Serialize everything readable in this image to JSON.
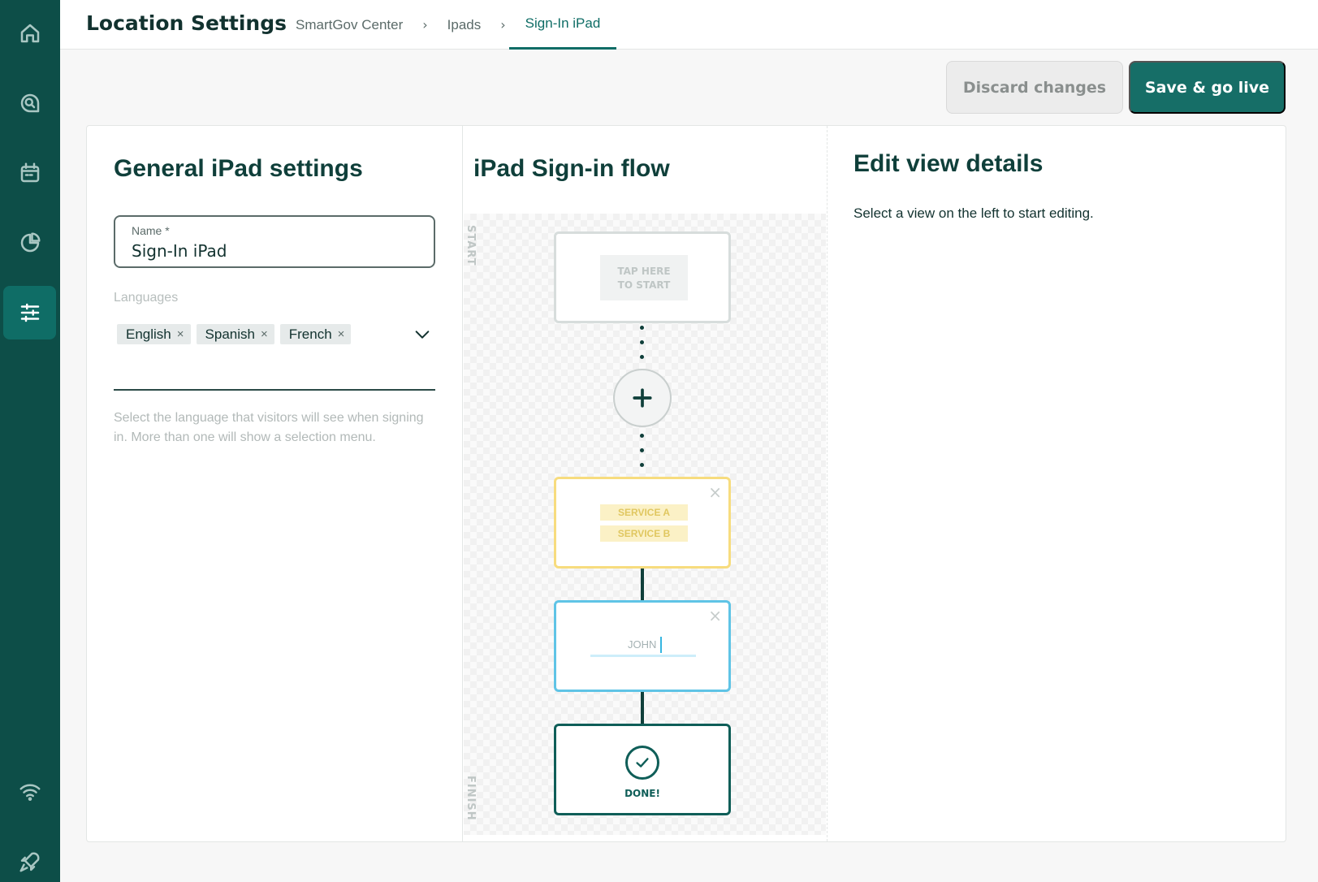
{
  "sidebar": {
    "items": [
      {
        "icon": "home-icon",
        "active": false
      },
      {
        "icon": "chat-search-icon",
        "active": false
      },
      {
        "icon": "calendar-icon",
        "active": false
      },
      {
        "icon": "pie-chart-icon",
        "active": false
      },
      {
        "icon": "sliders-icon",
        "active": true
      },
      {
        "icon": "wifi-icon",
        "active": false
      },
      {
        "icon": "rocket-icon",
        "active": false
      }
    ]
  },
  "header": {
    "title": "Location Settings",
    "breadcrumb": [
      "SmartGov Center",
      "Ipads",
      "Sign-In iPad"
    ],
    "separator": "›"
  },
  "actions": {
    "discard_label": "Discard changes",
    "save_label": "Save & go live"
  },
  "general": {
    "title": "General iPad settings",
    "name_label": "Name *",
    "name_value": "Sign-In iPad",
    "languages_label": "Languages",
    "languages": [
      "English",
      "Spanish",
      "French"
    ],
    "remove_glyph": "×",
    "help_text": "Select the language that visitors will see when signing in. More than one will show a selection menu."
  },
  "flow": {
    "title": "iPad Sign-in flow",
    "start_label": "START",
    "finish_label": "FINISH",
    "start_line1": "TAP HERE",
    "start_line2": "TO START",
    "service_a": "SERVICE A",
    "service_b": "SERVICE B",
    "input_placeholder": "JOHN",
    "done_label": "DONE!",
    "close_glyph": "×"
  },
  "edit": {
    "title_pre": "Edit ",
    "title_bold": "view",
    "title_post": " details",
    "hint": "Select a view on the left to start editing."
  },
  "colors": {
    "sidebar": "#0d4e48",
    "accent": "#166e67",
    "service_border": "#f7dc7e",
    "input_border": "#5fc4e6"
  }
}
